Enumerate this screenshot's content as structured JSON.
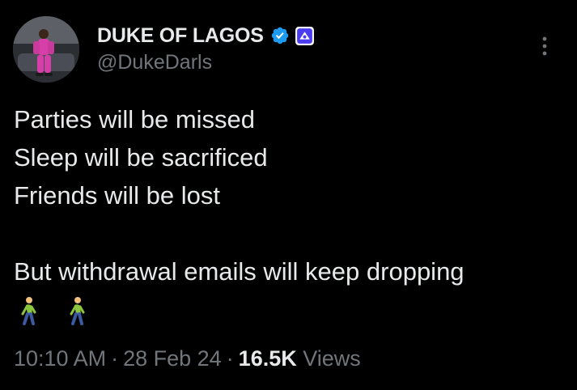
{
  "tweet": {
    "author": {
      "display_name": "DUKE OF LAGOS",
      "handle": "@DukeDarls",
      "verified": true,
      "verified_color": "#1d9bf0",
      "affiliate_badge": "gear-icon"
    },
    "text_lines": [
      "Parties will be missed",
      "Sleep will be sacrificed",
      "Friends will be lost",
      "",
      "But withdrawal emails will keep dropping"
    ],
    "emojis": [
      "man-walking",
      "man-walking"
    ],
    "meta": {
      "time": "10:10 AM",
      "separator": "·",
      "date": "28 Feb 24",
      "views_count": "16.5K",
      "views_label": "Views"
    }
  },
  "colors": {
    "background": "#000000",
    "primary_text": "#e7e9ea",
    "secondary_text": "#71767b",
    "accent": "#1d9bf0",
    "affiliate_badge": "#8a8bff"
  }
}
